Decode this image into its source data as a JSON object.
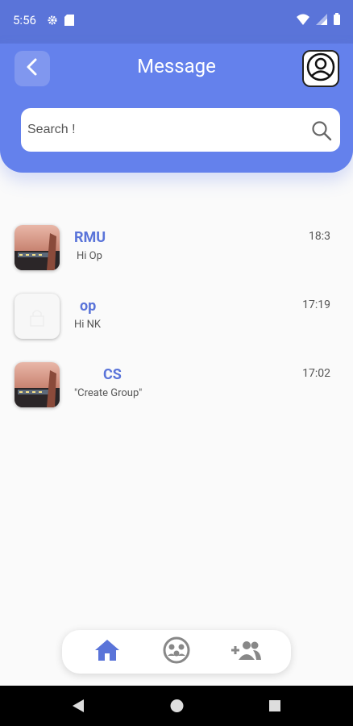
{
  "status_bar": {
    "time": "5:56",
    "icons": [
      "gear-icon",
      "sd-card-icon",
      "wifi-icon",
      "signal-icon",
      "battery-icon"
    ]
  },
  "header": {
    "title": "Message",
    "back_icon": "chevron-left-icon",
    "profile_icon": "user-circle-icon"
  },
  "search": {
    "placeholder": "Search !",
    "icon": "search-icon"
  },
  "chats": [
    {
      "name": "RMU",
      "message": "Hi Op",
      "time": "18:3",
      "avatar": "photo"
    },
    {
      "name": "op",
      "message": "Hi NK",
      "time": "17:19",
      "avatar": "blank"
    },
    {
      "name": "CS",
      "message": "\"Create Group\"",
      "time": "17:02",
      "avatar": "photo"
    }
  ],
  "bottom_nav": {
    "items": [
      "home-icon",
      "groups-icon",
      "add-friend-icon"
    ],
    "active": "home-icon"
  },
  "colors": {
    "primary": "#6481ec",
    "status_bar": "#5a74d9",
    "accent_text": "#5a74d9",
    "inactive_icon": "#888888"
  }
}
